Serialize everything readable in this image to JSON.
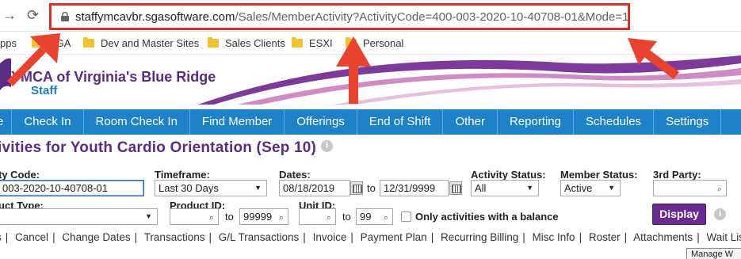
{
  "browser": {
    "back_icon": "back-arrow-icon",
    "reload_icon": "reload-icon",
    "url_host": "staffymcavbr.sgasoftware.com",
    "url_path": "/Sales/MemberActivity?ActivityCode=400-003-2020-10-40708-01&Mode=1",
    "bookmarks": [
      "pps",
      "SGA",
      "Dev and Master Sites",
      "Sales Clients",
      "ESXI",
      "Personal"
    ]
  },
  "brand": {
    "title": "YMCA of Virginia's Blue Ridge",
    "subtitle": "Staff"
  },
  "nav": [
    "e",
    "Check In",
    "Room Check In",
    "Find Member",
    "Offerings",
    "End of Shift",
    "Other",
    "Reporting",
    "Schedules",
    "Settings"
  ],
  "page": {
    "title": "ivities for Youth Cardio Orientation (Sep 10)",
    "info_glyph": "i"
  },
  "filters": {
    "activity_code_label": "ty Code:",
    "activity_code_value": "003-2020-10-40708-01",
    "timeframe_label": "Timeframe:",
    "timeframe_value": "Last 30 Days",
    "dates_label": "Dates:",
    "date_from": "08/18/2019",
    "date_to_word": "to",
    "date_to": "12/31/9999",
    "activity_status_label": "Activity Status:",
    "activity_status_value": "All",
    "member_status_label": "Member Status:",
    "member_status_value": "Active",
    "third_party_label": "3rd Party:",
    "product_type_label": "uct Type:",
    "product_id_label": "Product ID:",
    "product_id_to_word": "to",
    "product_id_to": "99999",
    "unit_id_label": "Unit ID:",
    "unit_id_to_word": "to",
    "unit_id_to": "99",
    "balance_label": "Only activities with a balance",
    "display_button": "Display"
  },
  "action_links": [
    "s",
    "Cancel",
    "Change Dates",
    "Transactions",
    "G/L Transactions",
    "Invoice",
    "Payment Plan",
    "Recurring Billing",
    "Misc Info",
    "Roster",
    "Attachments",
    "Wait List",
    ""
  ],
  "tooltip": "Manage W",
  "colors": {
    "annotation_red": "#e8432e",
    "ymca_purple": "#5b2c83",
    "nav_blue": "#1e82c8",
    "display_button": "#6a2a8f"
  }
}
